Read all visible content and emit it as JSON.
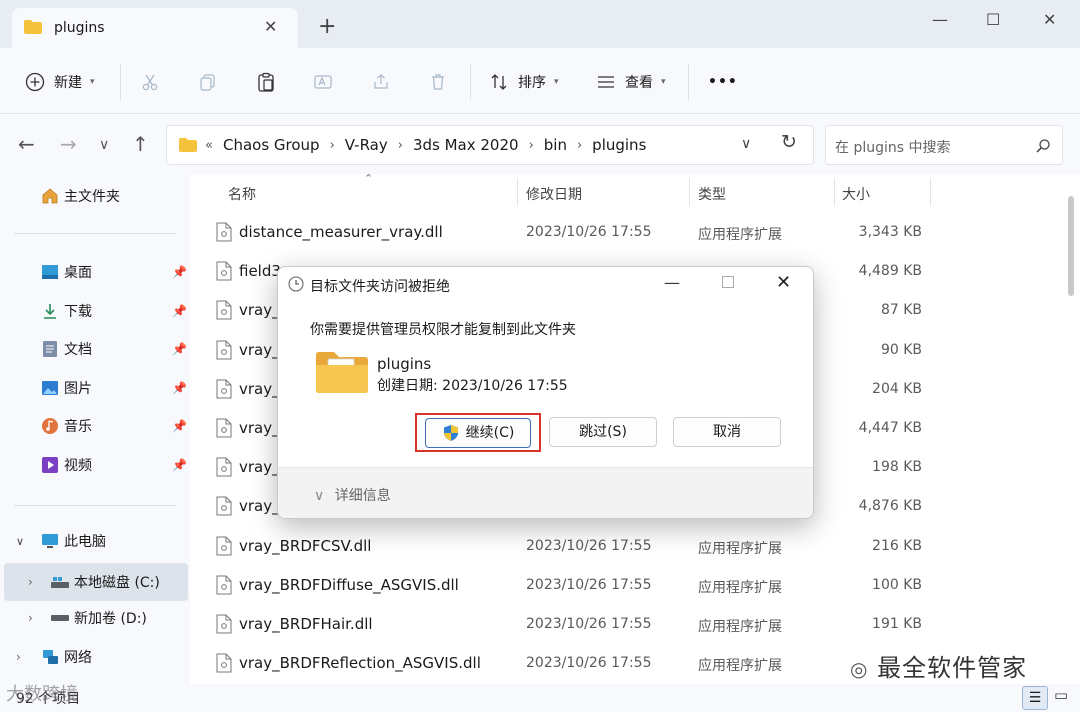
{
  "window": {
    "tab_title": "plugins",
    "new_tab": "+",
    "minimize": "—",
    "maximize": "☐",
    "close": "✕"
  },
  "toolbar": {
    "new_label": "新建",
    "sort_label": "排序",
    "view_label": "查看",
    "more_label": "•••"
  },
  "address": {
    "overflow": "«",
    "crumbs": [
      "Chaos Group",
      "V-Ray",
      "3ds Max 2020",
      "bin",
      "plugins"
    ],
    "search_placeholder": "在 plugins 中搜索"
  },
  "sidebar": {
    "home": "主文件夹",
    "quick": [
      {
        "label": "桌面",
        "icon": "desktop-icon"
      },
      {
        "label": "下载",
        "icon": "download-icon"
      },
      {
        "label": "文档",
        "icon": "document-icon"
      },
      {
        "label": "图片",
        "icon": "pictures-icon"
      },
      {
        "label": "音乐",
        "icon": "music-icon"
      },
      {
        "label": "视频",
        "icon": "video-icon"
      }
    ],
    "this_pc": "此电脑",
    "drive_c": "本地磁盘 (C:)",
    "drive_d": "新加卷 (D:)",
    "network": "网络"
  },
  "columns": {
    "name": "名称",
    "date": "修改日期",
    "type": "类型",
    "size": "大小"
  },
  "files": [
    {
      "name": "distance_measurer_vray.dll",
      "date": "2023/10/26 17:55",
      "type": "应用程序扩展",
      "size": "3,343 KB"
    },
    {
      "name": "field3",
      "date": "",
      "type": "",
      "size": "4,489 KB"
    },
    {
      "name": "vray_",
      "date": "",
      "type": "",
      "size": "87 KB"
    },
    {
      "name": "vray_",
      "date": "",
      "type": "",
      "size": "90 KB"
    },
    {
      "name": "vray_",
      "date": "",
      "type": "",
      "size": "204 KB"
    },
    {
      "name": "vray_",
      "date": "",
      "type": "",
      "size": "4,447 KB"
    },
    {
      "name": "vray_",
      "date": "",
      "type": "",
      "size": "198 KB"
    },
    {
      "name": "vray_",
      "date": "",
      "type": "",
      "size": "4,876 KB"
    },
    {
      "name": "vray_BRDFCSV.dll",
      "date": "2023/10/26 17:55",
      "type": "应用程序扩展",
      "size": "216 KB"
    },
    {
      "name": "vray_BRDFDiffuse_ASGVIS.dll",
      "date": "2023/10/26 17:55",
      "type": "应用程序扩展",
      "size": "100 KB"
    },
    {
      "name": "vray_BRDFHair.dll",
      "date": "2023/10/26 17:55",
      "type": "应用程序扩展",
      "size": "191 KB"
    },
    {
      "name": "vray_BRDFReflection_ASGVIS.dll",
      "date": "2023/10/26 17:55",
      "type": "应用程序扩展",
      "size": ""
    }
  ],
  "status": {
    "item_count": "92 个项目"
  },
  "dialog": {
    "title": "目标文件夹访问被拒绝",
    "message": "你需要提供管理员权限才能复制到此文件夹",
    "folder_name": "plugins",
    "created": "创建日期: 2023/10/26 17:55",
    "continue_label": "继续(C)",
    "skip_label": "跳过(S)",
    "cancel_label": "取消",
    "details_label": "详细信息"
  },
  "watermark": {
    "text": "最全软件管家",
    "text2": "大数跨境"
  }
}
